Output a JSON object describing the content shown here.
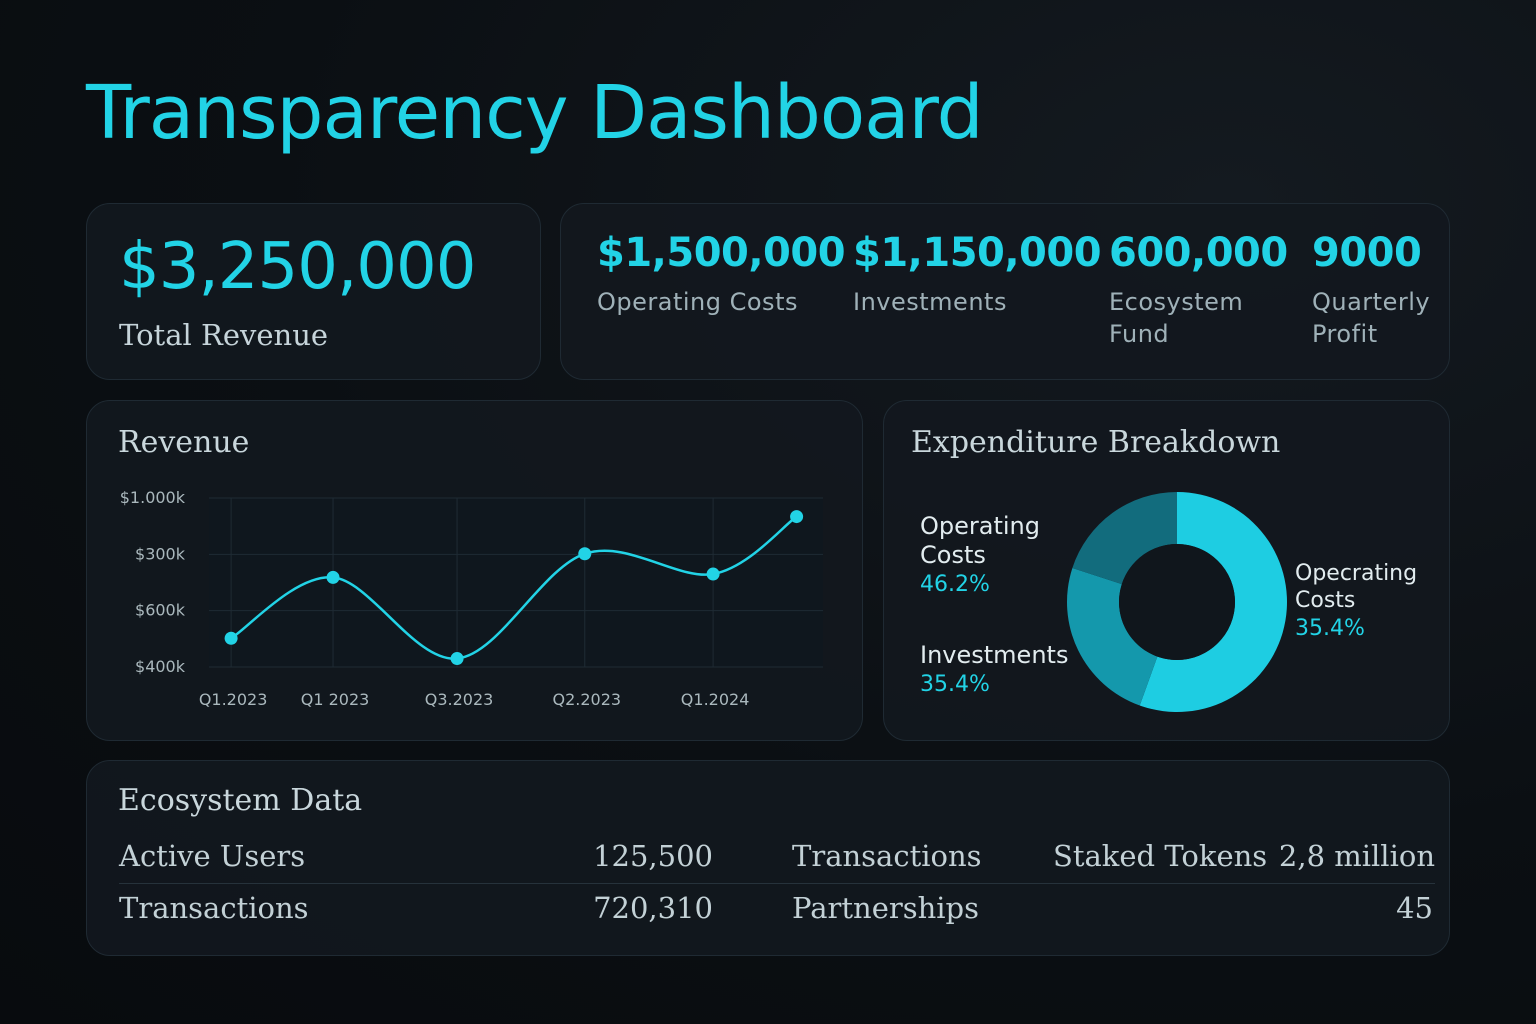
{
  "page": {
    "title": "Transparency Dashboard",
    "accent_color": "#22d3e6"
  },
  "total_revenue": {
    "value": "$3,250,000",
    "label": "Total Revenue"
  },
  "kpis": [
    {
      "value": "$1,500,000",
      "label": "Operating Costs"
    },
    {
      "value": "$1,150,000",
      "label": "Investments"
    },
    {
      "value": "600,000",
      "label": "Ecosystem Fund"
    },
    {
      "value": "9000",
      "label": "Quarterly Profit"
    }
  ],
  "revenue_chart": {
    "title": "Revenue",
    "chart_data": {
      "type": "line",
      "title": "Revenue",
      "y_tick_labels": [
        "$1.000k",
        "$300k",
        "$600k",
        "$400k"
      ],
      "x_tick_labels": [
        "Q1.2023",
        "Q1 2023",
        "Q3.2023",
        "Q2.2023",
        "Q1.2024"
      ],
      "points_y_position_on_axis": [
        0.17,
        0.53,
        0.05,
        0.67,
        0.55,
        0.89
      ],
      "grid": true,
      "line_color": "#22d3e6"
    }
  },
  "expenditure": {
    "title": "Expenditure Breakdown",
    "chart_data": {
      "type": "pie",
      "variant": "donut",
      "slices": [
        {
          "label": "Opecrating Costs",
          "value": 35.4,
          "color": "#1ecde2"
        },
        {
          "label": "Investments",
          "value": 35.4,
          "color": "#1498ac"
        },
        {
          "label": "",
          "value": 20.0,
          "color": "#126c7d"
        }
      ]
    },
    "labels": [
      {
        "name": "Operating Costs",
        "pct": "46.2%"
      },
      {
        "name": "Investments",
        "pct": "35.4%"
      },
      {
        "name": "Opecrating Costs",
        "pct": "35.4%"
      }
    ]
  },
  "ecosystem": {
    "title": "Ecosystem Data",
    "row1": {
      "left_label": "Active Users",
      "left_value": "125,500",
      "mid_label": "Transactions",
      "right_label": "Staked Tokens",
      "right_value": "2,8 million"
    },
    "row2": {
      "left_label": "Transactions",
      "left_value": "720,310",
      "mid_label": "Partnerships",
      "right_value": "45"
    }
  }
}
